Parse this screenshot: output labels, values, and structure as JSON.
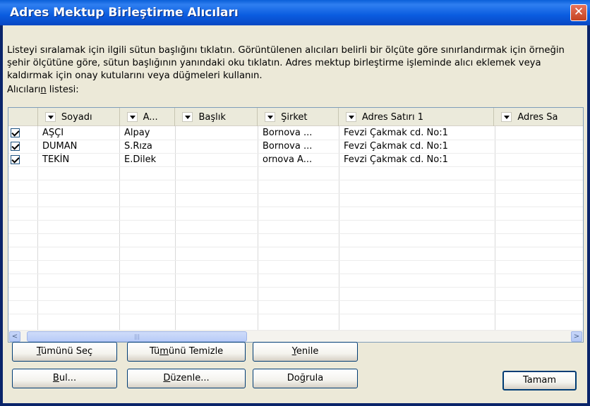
{
  "window": {
    "title": "Adres Mektup Birleştirme Alıcıları",
    "close_label": "✕"
  },
  "description": "Listeyi sıralamak için ilgili sütun başlığını tıklatın. Görüntülenen alıcıları belirli bir ölçüte göre sınırlandırmak için örneğin şehir ölçütüne göre, sütun başlığının yanındaki oku tıklatın. Adres mektup birleştirme işleminde alıcı eklemek veya kaldırmak için onay kutularını veya düğmeleri kullanın.",
  "list_label": "Alıcıların listesi:",
  "list": {
    "columns": [
      "",
      "Soyadı",
      "A...",
      "Başlık",
      "Şirket",
      "Adres Satırı 1",
      "Adres Sa"
    ],
    "rows": [
      {
        "checked": true,
        "cells": [
          "AŞÇI",
          "Alpay",
          "",
          "Bornova ...",
          "Fevzi Çakmak cd. No:1",
          ""
        ]
      },
      {
        "checked": true,
        "cells": [
          "DUMAN",
          "S.Rıza",
          "",
          "Bornova ...",
          "Fevzi Çakmak cd. No:1",
          ""
        ]
      },
      {
        "checked": true,
        "cells": [
          "TEKİN",
          "E.Dilek",
          "",
          "ornova A...",
          "Fevzi Çakmak cd. No:1",
          ""
        ]
      }
    ]
  },
  "scrollbar": {
    "left_arrow": "<",
    "right_arrow": ">",
    "thumb_grip": "|||"
  },
  "buttons": {
    "select_all": "Tümünü Seç",
    "clear_all": "Tümünü Temizle",
    "refresh": "Yenile",
    "find": "Bul...",
    "edit": "Düzenle...",
    "validate": "Doğrula",
    "ok": "Tamam"
  }
}
